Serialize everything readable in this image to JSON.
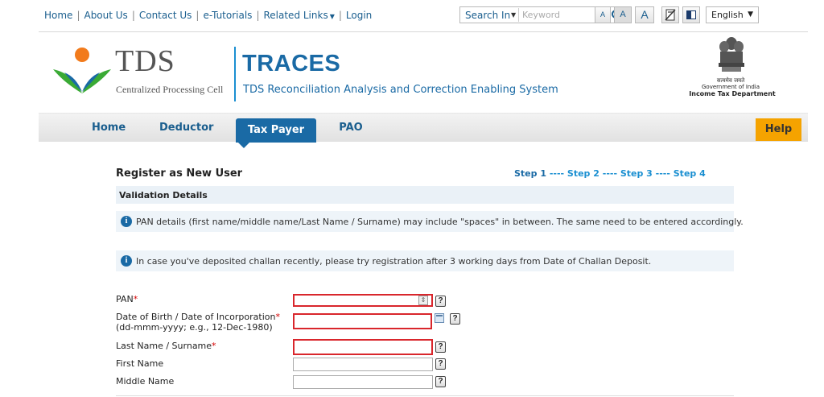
{
  "top_links": {
    "home": "Home",
    "about_us": "About Us",
    "contact_us": "Contact Us",
    "e_tutorials": "e-Tutorials",
    "related_links": "Related Links",
    "login": "Login",
    "separator": "|"
  },
  "search": {
    "scope_label": "Search In",
    "placeholder": "Keyword"
  },
  "font_size": {
    "small": "A",
    "medium": "A",
    "large": "A"
  },
  "language": {
    "selected": "English"
  },
  "header": {
    "tds_logo": "TDS",
    "tds_subtitle": "Centralized Processing Cell",
    "app_name": "TRACES",
    "app_full_name": "TDS Reconciliation Analysis and Correction Enabling System",
    "emblem_motto": "सत्यमेव जयते",
    "gov_line": "Government of India",
    "dept_line": "Income Tax Department"
  },
  "nav": {
    "items": [
      {
        "label": "Home"
      },
      {
        "label": "Deductor"
      },
      {
        "label": "Tax Payer",
        "active": true
      },
      {
        "label": "PAO"
      }
    ],
    "help": "Help"
  },
  "page": {
    "title": "Register as New User",
    "steps": {
      "step1": "Step 1",
      "rest": " ---- Step 2 ---- Step 3 ---- Step 4"
    },
    "section_title": "Validation Details",
    "info_icon": "i",
    "info1": "PAN details (first name/middle name/Last Name / Surname) may include \"spaces\" in between. The same need to be entered accordingly.",
    "info2": "In case you've deposited challan recently, please try registration after 3 working days from Date of Challan Deposit."
  },
  "form": {
    "required_mark": "*",
    "help_icon": "?",
    "pan_label": "PAN",
    "dob_label": "Date of Birth / Date of Incorporation",
    "dob_format": "(dd-mmm-yyyy; e.g., 12-Dec-1980)",
    "last_name_label": "Last Name / Surname",
    "first_name_label": "First Name",
    "middle_name_label": "Middle Name"
  },
  "colors": {
    "brand_blue": "#1a6aa5",
    "link_blue": "#1a5e8e",
    "help_orange": "#f5a300",
    "error_red": "#d9262c"
  }
}
